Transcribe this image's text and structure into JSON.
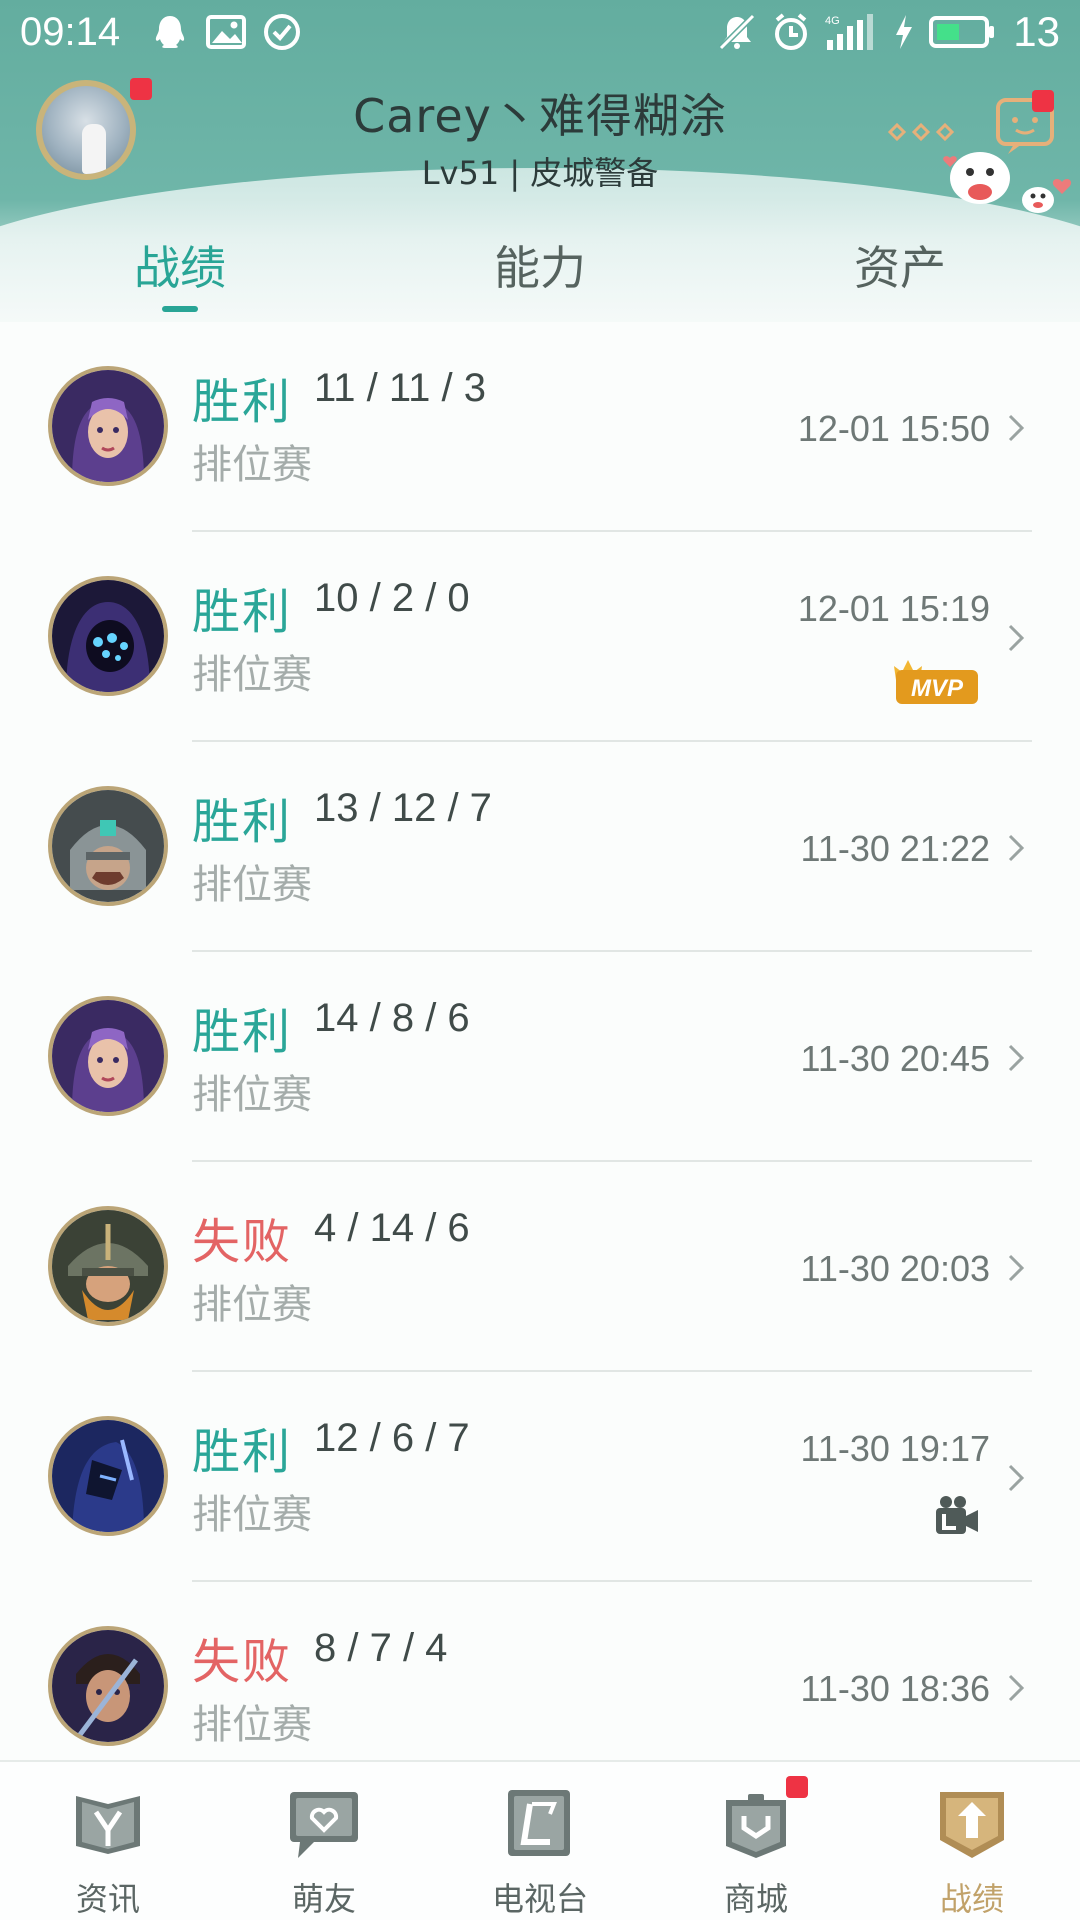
{
  "status_bar": {
    "time": "09:14",
    "network": "4G",
    "battery": "13"
  },
  "profile": {
    "nickname": "Carey丶难得糊涂",
    "level": "Lv51 | 皮城警备"
  },
  "tabs": [
    {
      "label": "战绩",
      "active": true
    },
    {
      "label": "能力",
      "active": false
    },
    {
      "label": "资产",
      "active": false
    }
  ],
  "matches": [
    {
      "result": "胜利",
      "outcome": "win",
      "kda": "11 / 11 / 3",
      "mode": "排位赛",
      "time": "12-01 15:50",
      "badge": "",
      "champion": "purple-mage"
    },
    {
      "result": "胜利",
      "outcome": "win",
      "kda": "10 / 2 / 0",
      "mode": "排位赛",
      "time": "12-01 15:19",
      "badge": "MVP",
      "champion": "hooded-void"
    },
    {
      "result": "胜利",
      "outcome": "win",
      "kda": "13 / 12 / 7",
      "mode": "排位赛",
      "time": "11-30 21:22",
      "badge": "",
      "champion": "armored-warrior"
    },
    {
      "result": "胜利",
      "outcome": "win",
      "kda": "14 / 8 / 6",
      "mode": "排位赛",
      "time": "11-30 20:45",
      "badge": "",
      "champion": "purple-mage"
    },
    {
      "result": "失败",
      "outcome": "loss",
      "kda": "4 / 14 / 6",
      "mode": "排位赛",
      "time": "11-30 20:03",
      "badge": "",
      "champion": "bearded-viking"
    },
    {
      "result": "胜利",
      "outcome": "win",
      "kda": "12 / 6 / 7",
      "mode": "排位赛",
      "time": "11-30 19:17",
      "badge": "replay",
      "champion": "dark-blade"
    },
    {
      "result": "失败",
      "outcome": "loss",
      "kda": "8 / 7 / 4",
      "mode": "排位赛",
      "time": "11-30 18:36",
      "badge": "",
      "champion": "dark-swordsman"
    }
  ],
  "nav": [
    {
      "label": "资讯",
      "icon": "news-icon",
      "active": false,
      "dot": false
    },
    {
      "label": "萌友",
      "icon": "friends-icon",
      "active": false,
      "dot": false
    },
    {
      "label": "电视台",
      "icon": "tv-icon",
      "active": false,
      "dot": false
    },
    {
      "label": "商城",
      "icon": "shop-icon",
      "active": false,
      "dot": true
    },
    {
      "label": "战绩",
      "icon": "record-icon",
      "active": true,
      "dot": false
    }
  ],
  "colors": {
    "accent": "#29a596",
    "win": "#2aa698",
    "loss": "#e36464",
    "header": "#63ad9f",
    "gold": "#c1a26a",
    "notification": "#ee3344"
  }
}
